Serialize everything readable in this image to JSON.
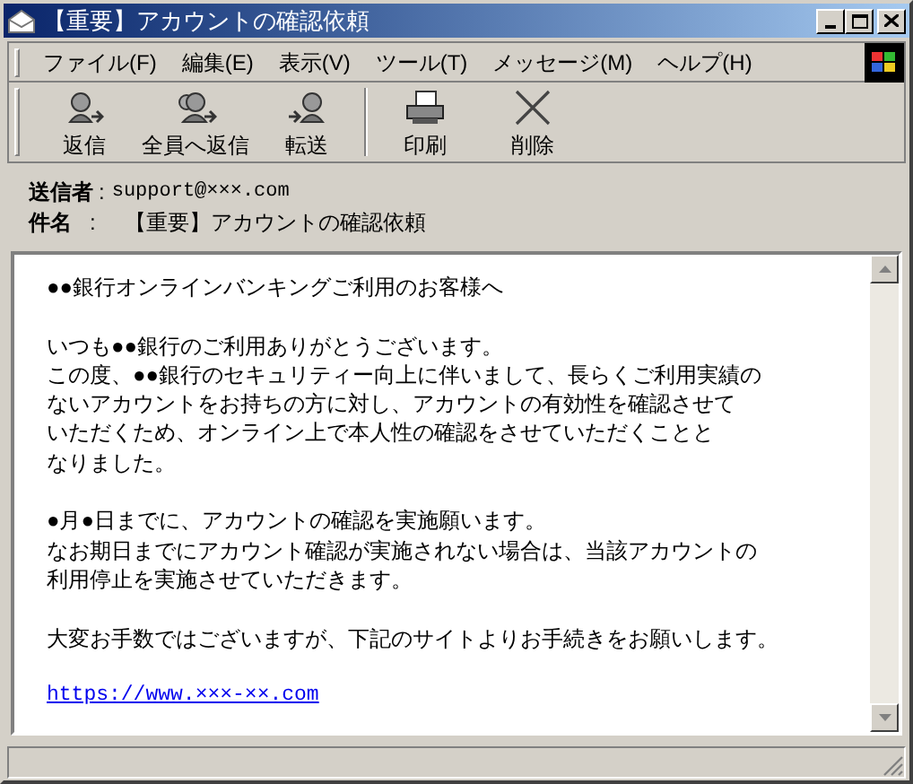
{
  "window": {
    "title": "【重要】アカウントの確認依頼"
  },
  "menu": [
    "ファイル(F)",
    "編集(E)",
    "表示(V)",
    "ツール(T)",
    "メッセージ(M)",
    "ヘルプ(H)"
  ],
  "toolbar": {
    "groups": [
      {
        "buttons": [
          {
            "kind": "reply",
            "label": "返信"
          },
          {
            "kind": "reply_all",
            "label": "全員へ返信"
          },
          {
            "kind": "forward",
            "label": "転送"
          }
        ]
      },
      {
        "buttons": [
          {
            "kind": "print",
            "label": "印刷"
          },
          {
            "kind": "delete",
            "label": "削除"
          }
        ]
      }
    ]
  },
  "header": {
    "from_label": "送信者",
    "from_colon": ":",
    "subject_colon": ":",
    "from": "support@×××.com",
    "subject_label": "件名",
    "subject": "【重要】アカウントの確認依頼"
  },
  "body": {
    "paragraphs": [
      [
        "●●銀行オンラインバンキングご利用のお客様へ"
      ],
      [
        "いつも●●銀行のご利用ありがとうございます。",
        "この度、●●銀行のセキュリティー向上に伴いまして、長らくご利用実績の",
        "ないアカウントをお持ちの方に対し、アカウントの有効性を確認させて",
        "いただくため、オンライン上で本人性の確認をさせていただくことと",
        "なりました。"
      ],
      [
        "●月●日までに、アカウントの確認を実施願います。",
        "なお期日までにアカウント確認が実施されない場合は、当該アカウントの",
        "利用停止を実施させていただきます。"
      ],
      [
        "大変お手数ではございますが、下記のサイトよりお手続きをお願いします。"
      ]
    ],
    "link": "https://www.×××-××.com"
  }
}
